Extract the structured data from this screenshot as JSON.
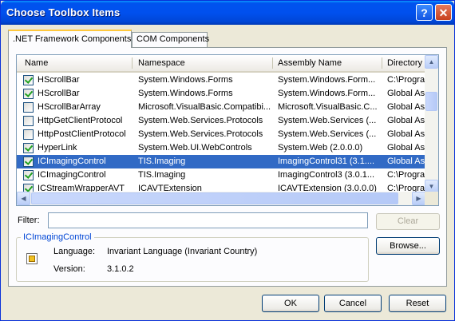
{
  "window": {
    "title": "Choose Toolbox Items",
    "help_glyph": "?",
    "close_glyph": "✕"
  },
  "tabs": [
    {
      "label": ".NET Framework Components",
      "active": true
    },
    {
      "label": "COM Components",
      "active": false
    }
  ],
  "grid": {
    "columns": [
      "Name",
      "Namespace",
      "Assembly Name",
      "Directory"
    ],
    "rows": [
      {
        "checked": true,
        "selected": false,
        "name": "HScrollBar",
        "namespace": "System.Windows.Forms",
        "assembly": "System.Windows.Form...",
        "directory": "C:\\Progra"
      },
      {
        "checked": true,
        "selected": false,
        "name": "HScrollBar",
        "namespace": "System.Windows.Forms",
        "assembly": "System.Windows.Form...",
        "directory": "Global Ass"
      },
      {
        "checked": false,
        "selected": false,
        "name": "HScrollBarArray",
        "namespace": "Microsoft.VisualBasic.Compatibi...",
        "assembly": "Microsoft.VisualBasic.C...",
        "directory": "Global Ass"
      },
      {
        "checked": false,
        "selected": false,
        "name": "HttpGetClientProtocol",
        "namespace": "System.Web.Services.Protocols",
        "assembly": "System.Web.Services (...",
        "directory": "Global Ass"
      },
      {
        "checked": false,
        "selected": false,
        "name": "HttpPostClientProtocol",
        "namespace": "System.Web.Services.Protocols",
        "assembly": "System.Web.Services (...",
        "directory": "Global Ass"
      },
      {
        "checked": true,
        "selected": false,
        "name": "HyperLink",
        "namespace": "System.Web.UI.WebControls",
        "assembly": "System.Web (2.0.0.0)",
        "directory": "Global Ass"
      },
      {
        "checked": true,
        "selected": true,
        "name": "ICImagingControl",
        "namespace": "TIS.Imaging",
        "assembly": "ImagingControl31 (3.1....",
        "directory": "Global Ass"
      },
      {
        "checked": true,
        "selected": false,
        "name": "ICImagingControl",
        "namespace": "TIS.Imaging",
        "assembly": "ImagingControl3 (3.0.1...",
        "directory": "C:\\Progra"
      },
      {
        "checked": true,
        "selected": false,
        "name": "ICStreamWrapperAVT",
        "namespace": "ICAVTExtension",
        "assembly": "ICAVTExtension (3.0.0.0)",
        "directory": "C:\\Progra"
      }
    ]
  },
  "filter": {
    "label": "Filter:",
    "value": "",
    "clear_label": "Clear"
  },
  "details": {
    "title": "ICImagingControl",
    "language_label": "Language:",
    "language_value": "Invariant Language (Invariant Country)",
    "version_label": "Version:",
    "version_value": "3.1.0.2",
    "browse_label": "Browse..."
  },
  "footer": {
    "ok_label": "OK",
    "cancel_label": "Cancel",
    "reset_label": "Reset"
  },
  "colors": {
    "selection": "#316ac5",
    "titlebar": "#0050ee",
    "legend_text": "#0046d5"
  },
  "icons": [
    "help-icon",
    "close-icon",
    "checkbox-icon",
    "scroll-up-arrow",
    "scroll-down-arrow",
    "scroll-left-arrow",
    "scroll-right-arrow",
    "component-icon"
  ]
}
